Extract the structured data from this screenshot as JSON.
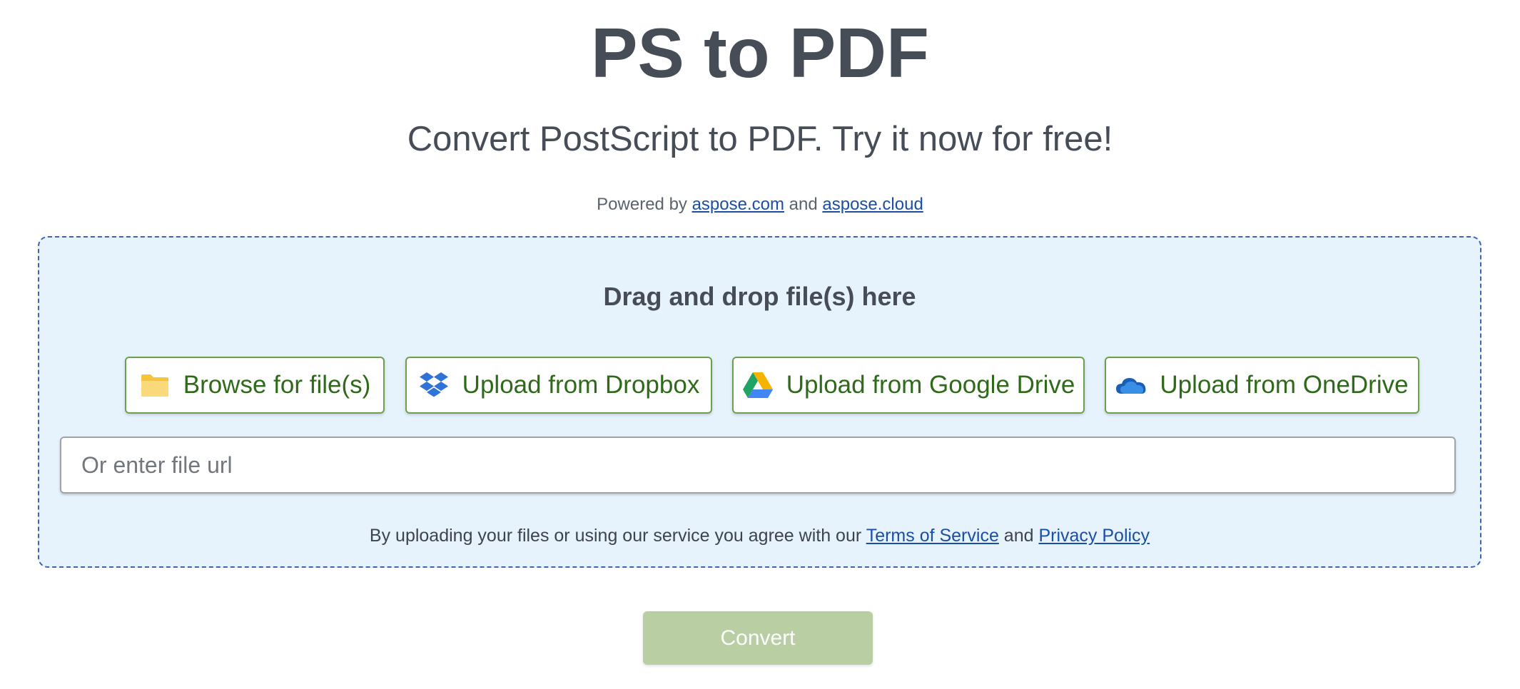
{
  "header": {
    "title": "PS to PDF",
    "subtitle": "Convert PostScript to PDF. Try it now for free!",
    "powered_prefix": "Powered by ",
    "powered_link1": "aspose.com",
    "powered_and": " and ",
    "powered_link2": "aspose.cloud"
  },
  "dropzone": {
    "title": "Drag and drop file(s) here",
    "buttons": {
      "browse": "Browse for file(s)",
      "dropbox": "Upload from Dropbox",
      "gdrive": "Upload from Google Drive",
      "onedrive": "Upload from OneDrive"
    },
    "url_placeholder": "Or enter file url",
    "url_value": "",
    "terms_prefix": "By uploading your files or using our service you agree with our ",
    "terms_link": "Terms of Service",
    "terms_and": " and ",
    "privacy_link": "Privacy Policy"
  },
  "icons": {
    "browse": "folder-icon",
    "dropbox": "dropbox-icon",
    "gdrive": "google-drive-icon",
    "onedrive": "onedrive-icon"
  },
  "actions": {
    "convert_label": "Convert"
  },
  "colors": {
    "accent_green": "#2f6a1a",
    "button_border": "#6aa14b",
    "convert_disabled": "#b9cfa3",
    "dropzone_bg": "#e6f2fc",
    "dropzone_border": "#3e63b5",
    "link": "#1b4fa6"
  }
}
